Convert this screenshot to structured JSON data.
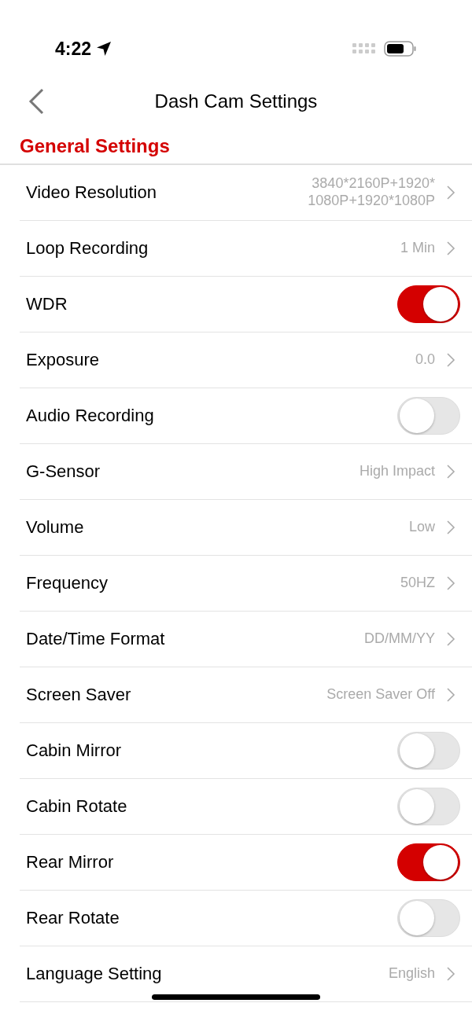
{
  "status_bar": {
    "time": "4:22"
  },
  "nav": {
    "title": "Dash Cam Settings"
  },
  "section": {
    "title": "General Settings"
  },
  "rows": [
    {
      "kind": "value",
      "label": "Video Resolution",
      "value": "3840*2160P+1920*\n1080P+1920*1080P"
    },
    {
      "kind": "value",
      "label": "Loop Recording",
      "value": "1 Min"
    },
    {
      "kind": "toggle",
      "label": "WDR",
      "on": true
    },
    {
      "kind": "value",
      "label": "Exposure",
      "value": "0.0"
    },
    {
      "kind": "toggle",
      "label": "Audio Recording",
      "on": false
    },
    {
      "kind": "value",
      "label": "G-Sensor",
      "value": "High Impact"
    },
    {
      "kind": "value",
      "label": "Volume",
      "value": "Low"
    },
    {
      "kind": "value",
      "label": "Frequency",
      "value": "50HZ"
    },
    {
      "kind": "value",
      "label": "Date/Time Format",
      "value": "DD/MM/YY"
    },
    {
      "kind": "value",
      "label": "Screen Saver",
      "value": "Screen Saver Off"
    },
    {
      "kind": "toggle",
      "label": "Cabin Mirror",
      "on": false
    },
    {
      "kind": "toggle",
      "label": "Cabin Rotate",
      "on": false
    },
    {
      "kind": "toggle",
      "label": "Rear Mirror",
      "on": true
    },
    {
      "kind": "toggle",
      "label": "Rear Rotate",
      "on": false
    },
    {
      "kind": "value",
      "label": "Language Setting",
      "value": "English"
    }
  ]
}
